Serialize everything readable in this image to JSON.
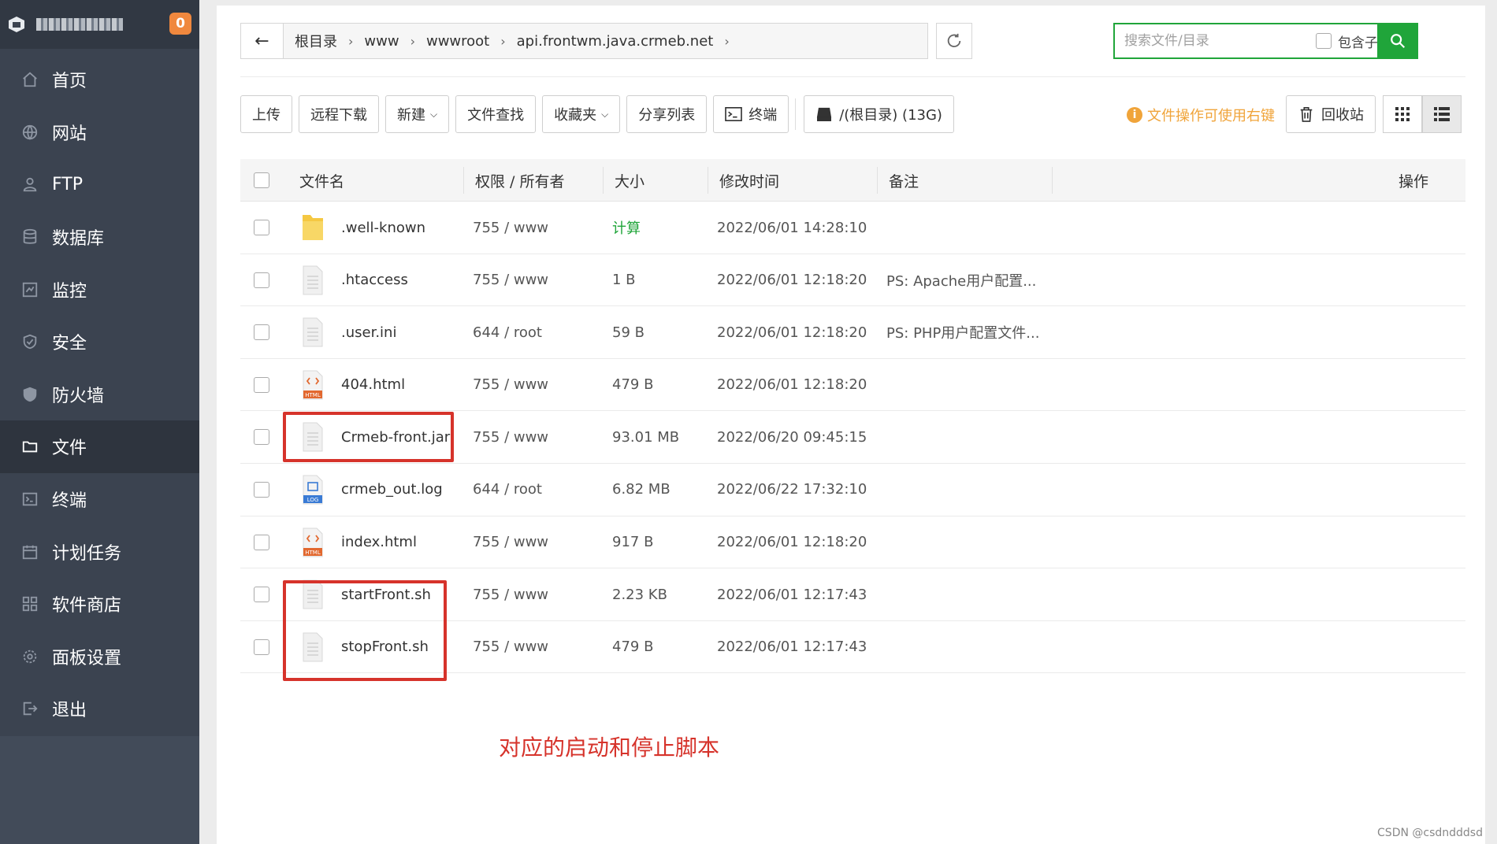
{
  "sidebar": {
    "badge_count": "0",
    "items": [
      {
        "label": "首页",
        "icon": "home-icon"
      },
      {
        "label": "网站",
        "icon": "globe-icon"
      },
      {
        "label": "FTP",
        "icon": "ftp-icon"
      },
      {
        "label": "数据库",
        "icon": "database-icon"
      },
      {
        "label": "监控",
        "icon": "monitor-icon"
      },
      {
        "label": "安全",
        "icon": "shield-icon"
      },
      {
        "label": "防火墙",
        "icon": "firewall-icon"
      },
      {
        "label": "文件",
        "icon": "folder-icon",
        "active": true
      },
      {
        "label": "终端",
        "icon": "terminal-icon"
      },
      {
        "label": "计划任务",
        "icon": "calendar-icon"
      },
      {
        "label": "软件商店",
        "icon": "apps-icon"
      },
      {
        "label": "面板设置",
        "icon": "gear-icon"
      },
      {
        "label": "退出",
        "icon": "logout-icon"
      }
    ]
  },
  "path": {
    "crumbs": [
      "根目录",
      "www",
      "wwwroot",
      "api.frontwm.java.crmeb.net"
    ]
  },
  "search": {
    "placeholder": "搜索文件/目录",
    "subdir_label": "包含子目录"
  },
  "toolbar": {
    "upload": "上传",
    "remote_download": "远程下载",
    "new": "新建",
    "file_search": "文件查找",
    "favorites": "收藏夹",
    "share_list": "分享列表",
    "terminal": "终端",
    "disk": "/(根目录) (13G)",
    "hint": "文件操作可使用右键",
    "recycle": "回收站"
  },
  "table": {
    "headers": {
      "name": "文件名",
      "perm": "权限 / 所有者",
      "size": "大小",
      "mtime": "修改时间",
      "note": "备注",
      "ops": "操作"
    },
    "rows": [
      {
        "name": ".well-known",
        "type": "folder",
        "perm": "755 / www",
        "size": "计算",
        "mtime": "2022/06/01 14:28:10",
        "note": ""
      },
      {
        "name": ".htaccess",
        "type": "file",
        "perm": "755 / www",
        "size": "1 B",
        "mtime": "2022/06/01 12:18:20",
        "note": "PS: Apache用户配置..."
      },
      {
        "name": ".user.ini",
        "type": "file",
        "perm": "644 / root",
        "size": "59 B",
        "mtime": "2022/06/01 12:18:20",
        "note": "PS: PHP用户配置文件..."
      },
      {
        "name": "404.html",
        "type": "html",
        "perm": "755 / www",
        "size": "479 B",
        "mtime": "2022/06/01 12:18:20",
        "note": ""
      },
      {
        "name": "Crmeb-front.jar",
        "type": "file",
        "perm": "755 / www",
        "size": "93.01 MB",
        "mtime": "2022/06/20 09:45:15",
        "note": ""
      },
      {
        "name": "crmeb_out.log",
        "type": "log",
        "perm": "644 / root",
        "size": "6.82 MB",
        "mtime": "2022/06/22 17:32:10",
        "note": ""
      },
      {
        "name": "index.html",
        "type": "html",
        "perm": "755 / www",
        "size": "917 B",
        "mtime": "2022/06/01 12:18:20",
        "note": ""
      },
      {
        "name": "startFront.sh",
        "type": "file",
        "perm": "755 / www",
        "size": "2.23 KB",
        "mtime": "2022/06/01 12:17:43",
        "note": ""
      },
      {
        "name": "stopFront.sh",
        "type": "file",
        "perm": "755 / www",
        "size": "479 B",
        "mtime": "2022/06/01 12:17:43",
        "note": ""
      }
    ]
  },
  "annotation": "对应的启动和停止脚本",
  "watermark": "CSDN @csdndddsd",
  "colors": {
    "accent": "#20a53a",
    "highlight": "#d6332b",
    "hint": "#f0a43a",
    "sidebar": "#3b4350"
  }
}
